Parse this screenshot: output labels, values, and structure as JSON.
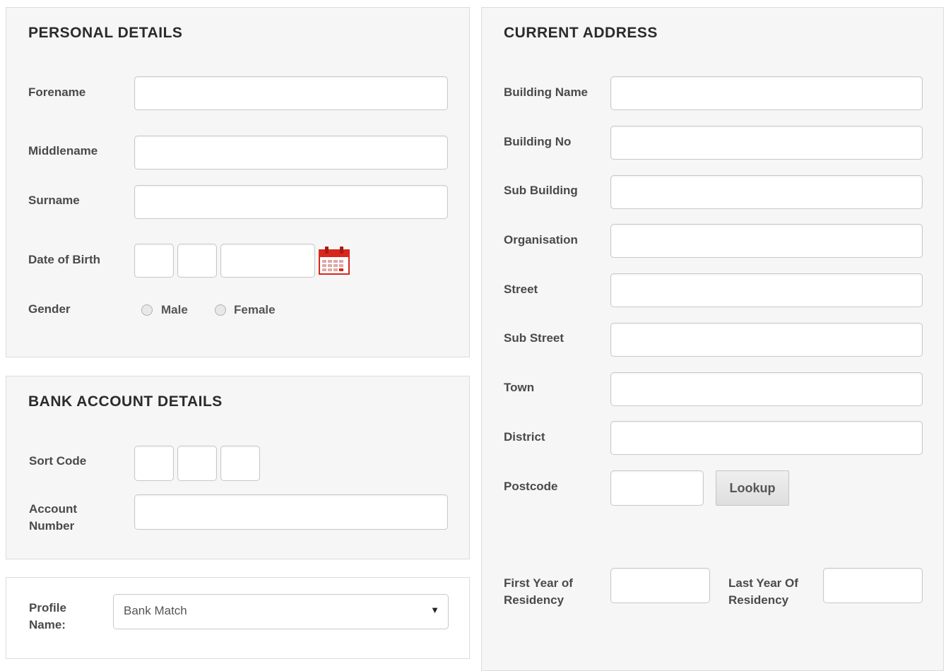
{
  "personal": {
    "title": "PERSONAL DETAILS",
    "forename_label": "Forename",
    "middlename_label": "Middlename",
    "surname_label": "Surname",
    "dob_label": "Date of Birth",
    "gender_label": "Gender",
    "male_label": "Male",
    "female_label": "Female"
  },
  "bank": {
    "title": "BANK ACCOUNT DETAILS",
    "sort_code_label": "Sort Code",
    "account_number_label_1": "Account",
    "account_number_label_2": "Number"
  },
  "profile": {
    "label_1": "Profile",
    "label_2": "Name:",
    "selected": "Bank Match"
  },
  "address": {
    "title": "CURRENT ADDRESS",
    "building_name_label": "Building Name",
    "building_no_label": "Building No",
    "sub_building_label": "Sub Building",
    "organisation_label": "Organisation",
    "street_label": "Street",
    "sub_street_label": "Sub Street",
    "town_label": "Town",
    "district_label": "District",
    "postcode_label": "Postcode",
    "lookup_label": "Lookup",
    "first_year_label_1": "First Year of",
    "first_year_label_2": "Residency",
    "last_year_label_1": "Last Year Of",
    "last_year_label_2": "Residency"
  },
  "icons": {
    "calendar": "calendar-icon",
    "dropdown": "chevron-down-icon"
  },
  "colors": {
    "calendar_red": "#d9261c"
  }
}
